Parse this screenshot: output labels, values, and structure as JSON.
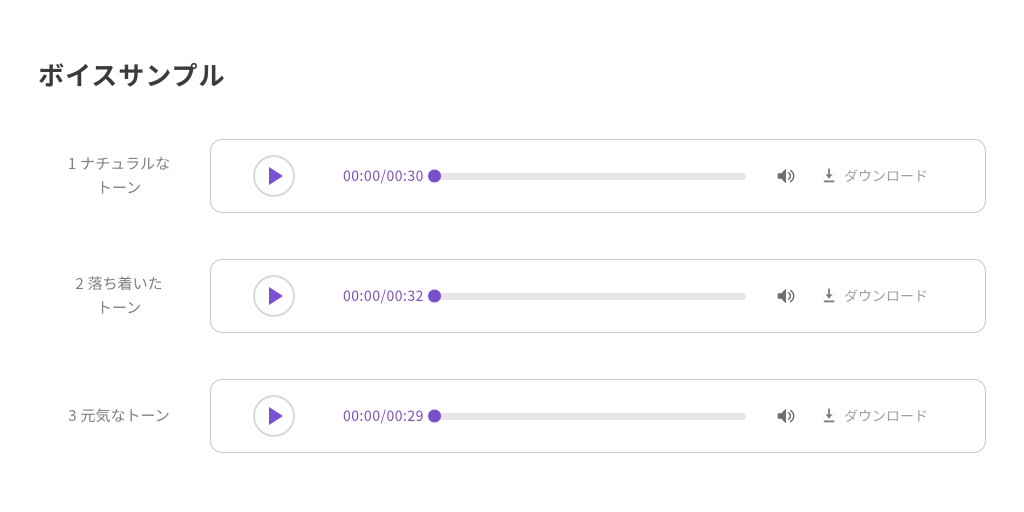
{
  "title": "ボイスサンプル",
  "download_label": "ダウンロード",
  "samples": [
    {
      "index": "1",
      "name_line1": "ナチュラルな",
      "name_line2": "トーン",
      "position": "00:00",
      "duration": "00:30"
    },
    {
      "index": "2",
      "name_line1": "落ち着いた",
      "name_line2": "トーン",
      "position": "00:00",
      "duration": "00:32"
    },
    {
      "index": "3",
      "name_line1": "元気なトーン",
      "name_line2": "",
      "position": "00:00",
      "duration": "00:29"
    }
  ]
}
